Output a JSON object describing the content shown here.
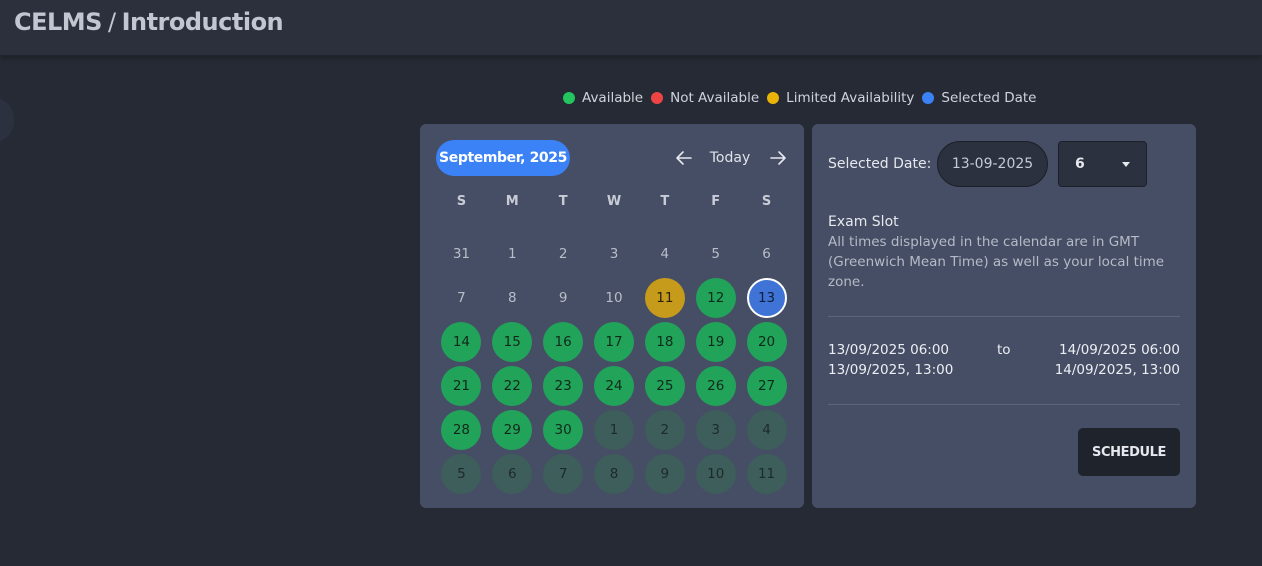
{
  "header": {
    "app": "CELMS",
    "separator": "/",
    "page": "Introduction"
  },
  "legend": [
    {
      "label": "Available",
      "color": "#22c55e"
    },
    {
      "label": "Not Available",
      "color": "#ef4444"
    },
    {
      "label": "Limited Availability",
      "color": "#eab308"
    },
    {
      "label": "Selected Date",
      "color": "#3b82f6"
    }
  ],
  "calendar": {
    "month_label": "September, 2025",
    "today_label": "Today",
    "weekdays": [
      "S",
      "M",
      "T",
      "W",
      "T",
      "F",
      "S"
    ],
    "days": [
      {
        "label": "31",
        "status": "outside"
      },
      {
        "label": "1",
        "status": "outside"
      },
      {
        "label": "2",
        "status": "outside"
      },
      {
        "label": "3",
        "status": "outside"
      },
      {
        "label": "4",
        "status": "outside"
      },
      {
        "label": "5",
        "status": "outside"
      },
      {
        "label": "6",
        "status": "outside"
      },
      {
        "label": "7",
        "status": "outside"
      },
      {
        "label": "8",
        "status": "outside"
      },
      {
        "label": "9",
        "status": "outside"
      },
      {
        "label": "10",
        "status": "outside"
      },
      {
        "label": "11",
        "status": "limited"
      },
      {
        "label": "12",
        "status": "available"
      },
      {
        "label": "13",
        "status": "selected"
      },
      {
        "label": "14",
        "status": "available"
      },
      {
        "label": "15",
        "status": "available"
      },
      {
        "label": "16",
        "status": "available"
      },
      {
        "label": "17",
        "status": "available"
      },
      {
        "label": "18",
        "status": "available"
      },
      {
        "label": "19",
        "status": "available"
      },
      {
        "label": "20",
        "status": "available"
      },
      {
        "label": "21",
        "status": "available"
      },
      {
        "label": "22",
        "status": "available"
      },
      {
        "label": "23",
        "status": "available"
      },
      {
        "label": "24",
        "status": "available"
      },
      {
        "label": "25",
        "status": "available"
      },
      {
        "label": "26",
        "status": "available"
      },
      {
        "label": "27",
        "status": "available"
      },
      {
        "label": "28",
        "status": "available"
      },
      {
        "label": "29",
        "status": "available"
      },
      {
        "label": "30",
        "status": "available"
      },
      {
        "label": "1",
        "status": "next-month"
      },
      {
        "label": "2",
        "status": "next-month"
      },
      {
        "label": "3",
        "status": "next-month"
      },
      {
        "label": "4",
        "status": "next-month"
      },
      {
        "label": "5",
        "status": "next-month"
      },
      {
        "label": "6",
        "status": "next-month"
      },
      {
        "label": "7",
        "status": "next-month"
      },
      {
        "label": "8",
        "status": "next-month"
      },
      {
        "label": "9",
        "status": "next-month"
      },
      {
        "label": "10",
        "status": "next-month"
      },
      {
        "label": "11",
        "status": "next-month"
      }
    ]
  },
  "booking": {
    "selected_date_label": "Selected Date:",
    "selected_date_value": "13-09-2025",
    "hour_value": "6",
    "slot_title": "Exam Slot",
    "slot_description": "All times displayed in the calendar are in GMT (Greenwich Mean Time) as well as your local time zone.",
    "start_gmt": "13/09/2025 06:00",
    "start_local": "13/09/2025, 13:00",
    "to_label": "to",
    "end_gmt": "14/09/2025 06:00",
    "end_local": "14/09/2025, 13:00",
    "schedule_label": "SCHEDULE"
  }
}
